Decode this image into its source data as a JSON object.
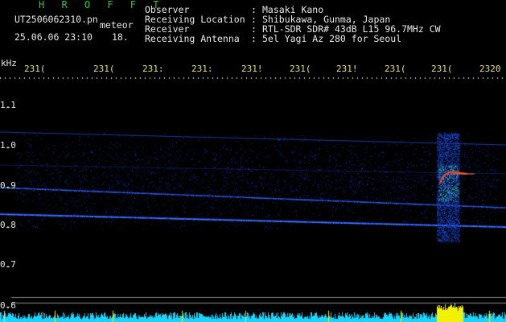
{
  "header": {
    "program": "H R O F F T",
    "filename": "UT2506062310.pn",
    "mode": "meteor",
    "datetime": "25.06.06 23:10",
    "extra": "18.",
    "fields": [
      {
        "label": "Observer",
        "value": "Masaki Kano"
      },
      {
        "label": "Receiving Location",
        "value": "Shibukawa, Gunma, Japan"
      },
      {
        "label": "Receiver",
        "value": "RTL-SDR SDR# 43dB L15 96.7MHz CW"
      },
      {
        "label": "Receiving Antenna",
        "value": "5el Yagi Az 280 for Seoul"
      }
    ],
    "separator": ":"
  },
  "axis": {
    "unit": "kHz",
    "x_ticks": [
      "231(",
      "231(",
      "231:",
      "231:",
      "231!",
      "231(",
      "231!",
      "231(",
      "231(",
      "2320"
    ],
    "y_ticks": [
      "1.1",
      "1.0",
      "0.9",
      "0.8",
      "0.7",
      "0.6"
    ]
  },
  "colors": {
    "background": "#000000",
    "header_text": "#29c93a",
    "tick_text": "#e6e27a",
    "signal_low": "#1a2cff",
    "signal_high": "#ff3a2a",
    "baseline": "#18d4ff",
    "burst_power": "#f2f200"
  }
}
